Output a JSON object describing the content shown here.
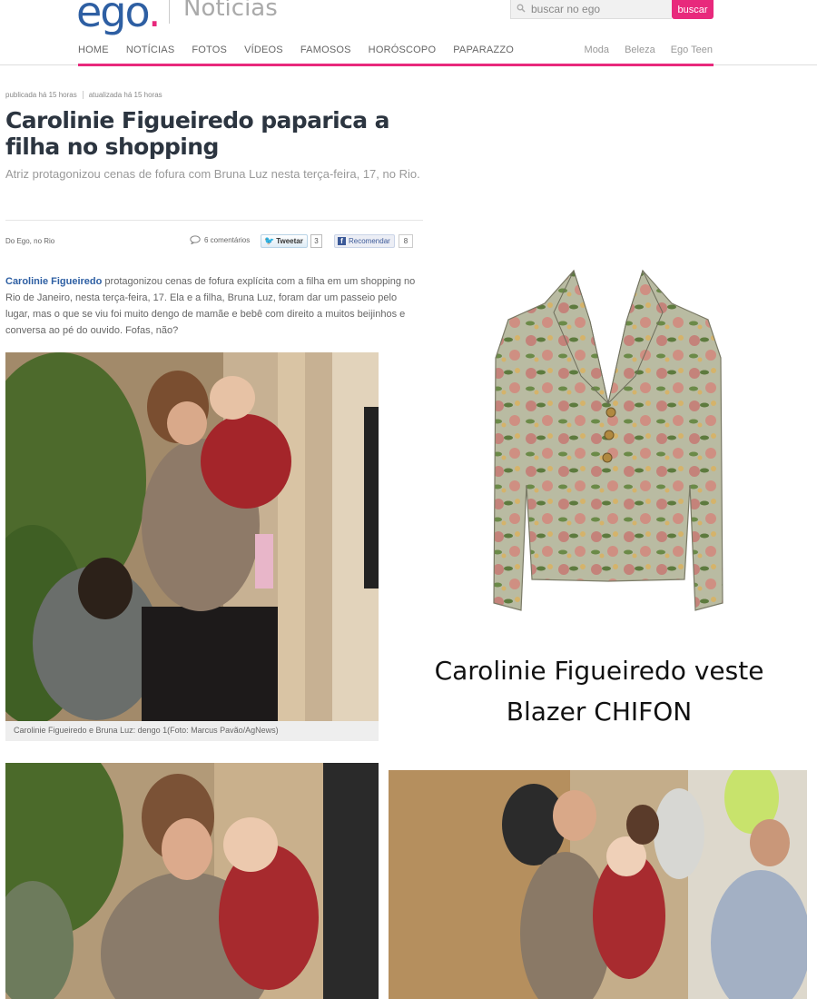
{
  "header": {
    "logo": "ego",
    "logo_dot": ".",
    "section": "Notícias",
    "search_placeholder": "buscar no ego",
    "search_button": "buscar"
  },
  "nav": {
    "items": [
      "HOME",
      "NOTÍCIAS",
      "FOTOS",
      "VÍDEOS",
      "FAMOSOS",
      "HORÓSCOPO",
      "PAPARAZZO"
    ],
    "right_items": [
      "Moda",
      "Beleza",
      "Ego Teen"
    ]
  },
  "article": {
    "published": "publicada há 15 horas",
    "updated": "atualizada há 15 horas",
    "title": "Carolinie Figueiredo paparica a filha no shopping",
    "subtitle": "Atriz protagonizou cenas de fofura com Bruna Luz nesta terça-feira, 17, no Rio.",
    "byline": "Do Ego, no Rio",
    "comments": "6 comentários",
    "tweet_label": "Tweetar",
    "tweet_count": "3",
    "fb_label": "Recomendar",
    "fb_count": "8",
    "body_link": "Carolinie Figueiredo",
    "body_text": " protagonizou cenas de fofura explícita com a filha em um shopping no Rio de Janeiro, nesta terça-feira, 17. Ela e a filha, Bruna Luz, foram dar um passeio pelo lugar, mas o que se viu foi muito dengo de mamãe e bebê com direito a muitos beijinhos e conversa ao pé do ouvido. Fofas, não?",
    "photo_caption": "Carolinie Figueiredo e Bruna Luz: dengo 1(Foto: Marcus Pavão/AgNews)"
  },
  "product": {
    "caption_line1": "Carolinie Figueiredo veste",
    "caption_line2": "Blazer CHIFON"
  },
  "colors": {
    "brand_blue": "#2e5fa3",
    "brand_pink": "#e8297c",
    "title_color": "#2c3540"
  }
}
